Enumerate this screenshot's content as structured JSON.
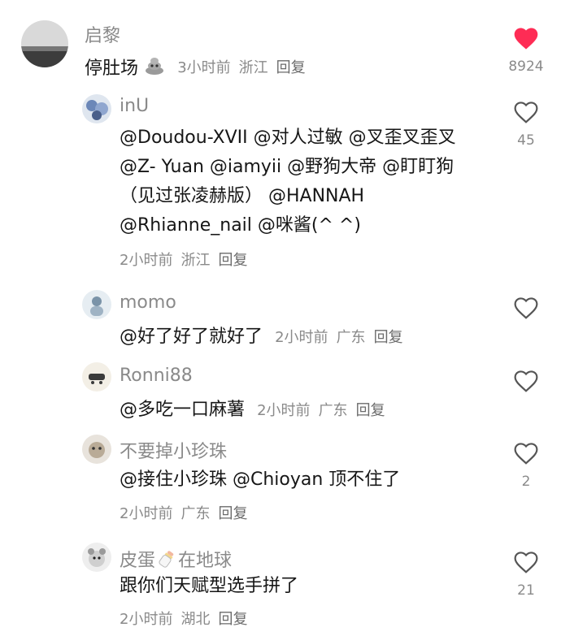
{
  "comments": [
    {
      "user": "启黎",
      "text": "停肚场",
      "time": "3小时前",
      "location": "浙江",
      "reply": "回复",
      "likes": "8924",
      "liked": true
    },
    {
      "user": "inU",
      "text": "@Doudou-XVII @对人过敏 @叉歪叉歪叉 @Z- Yuan @iamyii @野狗大帝 @盯盯狗（见过张凌赫版） @HANNAH @Rhianne_nail @咪酱(^ ^)",
      "time": "2小时前",
      "location": "浙江",
      "reply": "回复",
      "likes": "45",
      "liked": false
    },
    {
      "user": "momo",
      "text": "@好了好了就好了",
      "time": "2小时前",
      "location": "广东",
      "reply": "回复",
      "likes": "",
      "liked": false
    },
    {
      "user": "Ronni88",
      "text": "@多吃一口麻薯",
      "time": "2小时前",
      "location": "广东",
      "reply": "回复",
      "likes": "",
      "liked": false
    },
    {
      "user": "不要掉小珍珠",
      "text": "@接住小珍珠 @Chioyan 顶不住了",
      "time": "2小时前",
      "location": "广东",
      "reply": "回复",
      "likes": "2",
      "liked": false
    },
    {
      "user": "皮蛋在地球",
      "user_part1": "皮蛋",
      "user_part2": "在地球",
      "text": "跟你们天赋型选手拼了",
      "time": "2小时前",
      "location": "湖北",
      "reply": "回复",
      "likes": "21",
      "liked": false
    }
  ],
  "icons": {
    "heart": "heart-icon",
    "poop_emoji": "poop-emoji-icon",
    "baby_bottle_emoji": "baby-bottle-emoji-icon"
  },
  "colors": {
    "liked_heart": "#fe2c55",
    "muted_text": "#8a8a8a",
    "text": "#161616"
  }
}
